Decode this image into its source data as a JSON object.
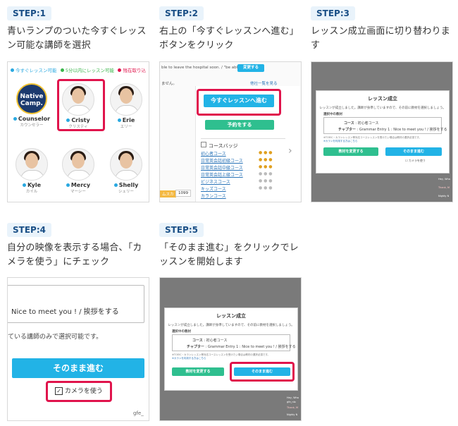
{
  "steps": [
    {
      "badge": "STEP:1",
      "desc": "青いランプのついた今すぐレッスン可能な講師を選択"
    },
    {
      "badge": "STEP:2",
      "desc": "右上の「今すぐレッスンへ進む」ボタンをクリック"
    },
    {
      "badge": "STEP:3",
      "desc": "レッスン成立画面に切り替わります"
    },
    {
      "badge": "STEP:4",
      "desc": "自分の映像を表示する場合、「カメラを使う」にチェック"
    },
    {
      "badge": "STEP:5",
      "desc": "「そのまま進む」をクリックでレッスンを開始します"
    }
  ],
  "shot1": {
    "legend": [
      "今すぐレッスン可能",
      "5分以内にレッスン可能",
      "残在取り込"
    ],
    "legend_colors": [
      "#29a8e0",
      "#39b54a",
      "#e0144c"
    ],
    "logo_top": "Native",
    "logo_bottom": "Camp.",
    "tutors": [
      {
        "name": "Counselor",
        "sub": "カウンセラー"
      },
      {
        "name": "Cristy",
        "sub": "クリスティ"
      },
      {
        "name": "Erie",
        "sub": "エリー"
      },
      {
        "name": "Kyle",
        "sub": "カイル"
      },
      {
        "name": "Mercy",
        "sub": "マーシー"
      },
      {
        "name": "Shelly",
        "sub": "シェリー"
      }
    ]
  },
  "shot2": {
    "top_text": "ble to leave the hospital soon. / \"be able",
    "change_btn": "変更する",
    "sub_text": "ません。",
    "link_text": "他社一覧を見る",
    "primary_btn": "今すぐレッスンへ進む",
    "reserve_btn": "予約をする",
    "course_heading": "コースバッジ",
    "courses": [
      "初心者コース",
      "日常英会話初級コース",
      "日常英会話中級コース",
      "日常英会話上級コース",
      "ビジネスコース",
      "キッズコース",
      "カランコース"
    ],
    "tag": "ムスカ",
    "count": "1099"
  },
  "modal": {
    "title": "レッスン成立",
    "line1": "レッスンが成立しました。講師が身準していますので、その前に教材を選択しましょう。",
    "section": "選択中の教材",
    "course_label": "コース",
    "course_value": "初心者コース",
    "chapter_label": "チャプター",
    "chapter_value": "Grammar Entry 1 : Nice to meet you ! / 挨拶をする",
    "note1": "※TOEIC・カランレッスン等対応コースレッスンを受けたい場合は教材の選択必須です。",
    "note2": "※カランを利用する方はこちら",
    "change_btn": "教材を変更する",
    "proceed_btn": "そのまま進む",
    "camera": "カメラを使う",
    "side": [
      "Hey, Wha",
      "gfe_nlo",
      "Thank, M",
      "Nighty N"
    ]
  },
  "shot4": {
    "field_text": "Nice to meet you ! / 挨拶をする",
    "note": "ている講師のみで選択可能です。",
    "proceed_btn": "そのまま進む",
    "camera": "カメラを使う",
    "corner": "gfe_"
  }
}
